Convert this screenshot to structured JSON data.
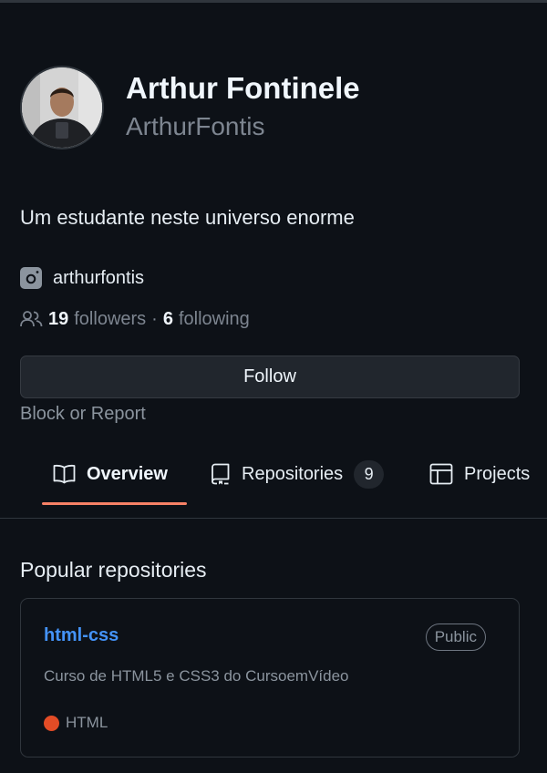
{
  "profile": {
    "display_name": "Arthur Fontinele",
    "username": "ArthurFontis",
    "bio": "Um estudante neste universo enorme",
    "social": {
      "icon": "instagram-icon",
      "handle": "arthurfontis"
    },
    "followers_count": "19",
    "followers_label": "followers",
    "separator": "·",
    "following_count": "6",
    "following_label": "following"
  },
  "actions": {
    "follow_label": "Follow",
    "block_label": "Block or Report"
  },
  "tabs": [
    {
      "label": "Overview",
      "icon": "book-icon",
      "active": true
    },
    {
      "label": "Repositories",
      "icon": "repo-icon",
      "count": "9"
    },
    {
      "label": "Projects",
      "icon": "table-icon"
    }
  ],
  "popular": {
    "title": "Popular repositories",
    "repos": [
      {
        "name": "html-css",
        "visibility": "Public",
        "description": "Curso de HTML5 e CSS3 do CursoemVídeo",
        "language": "HTML",
        "language_color": "#e34c26"
      }
    ]
  },
  "colors": {
    "background": "#0d1117",
    "link": "#4493f8",
    "tab_underline": "#f78166",
    "muted": "#7d8590"
  }
}
